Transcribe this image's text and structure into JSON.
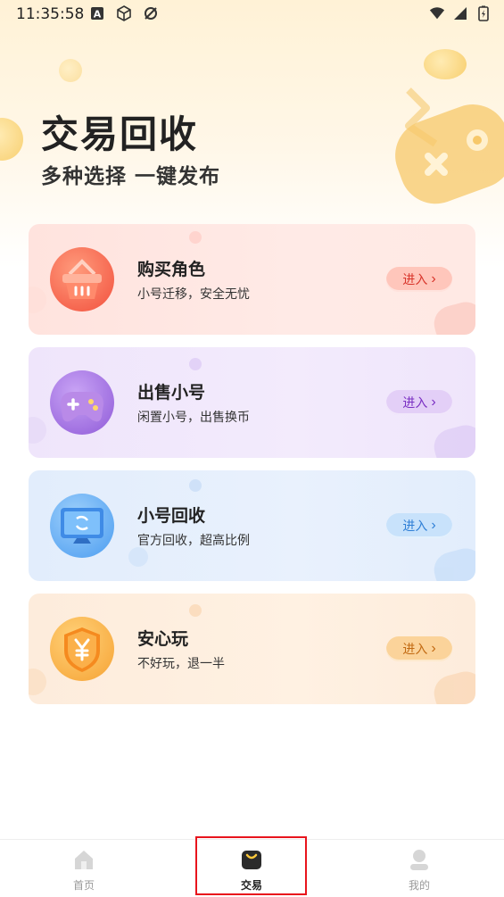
{
  "status_bar": {
    "time": "11:35:58"
  },
  "hero": {
    "title": "交易回收",
    "subtitle": "多种选择 一键发布"
  },
  "cards": [
    {
      "title": "购买角色",
      "desc": "小号迁移，安全无忧",
      "button": "进入",
      "icon": "basket-icon",
      "accent": "#e04a3c"
    },
    {
      "title": "出售小号",
      "desc": "闲置小号，出售换币",
      "button": "进入",
      "icon": "gamepad-icon",
      "accent": "#8e3ad6"
    },
    {
      "title": "小号回收",
      "desc": "官方回收，超高比例",
      "button": "进入",
      "icon": "monitor-recycle-icon",
      "accent": "#2f7fd6"
    },
    {
      "title": "安心玩",
      "desc": "不好玩，退一半",
      "button": "进入",
      "icon": "shield-yen-icon",
      "accent": "#d07a16"
    }
  ],
  "tabbar": {
    "tabs": [
      {
        "label": "首页",
        "icon": "home-icon",
        "active": false
      },
      {
        "label": "交易",
        "icon": "bag-icon",
        "active": true
      },
      {
        "label": "我的",
        "icon": "profile-icon",
        "active": false
      }
    ]
  }
}
